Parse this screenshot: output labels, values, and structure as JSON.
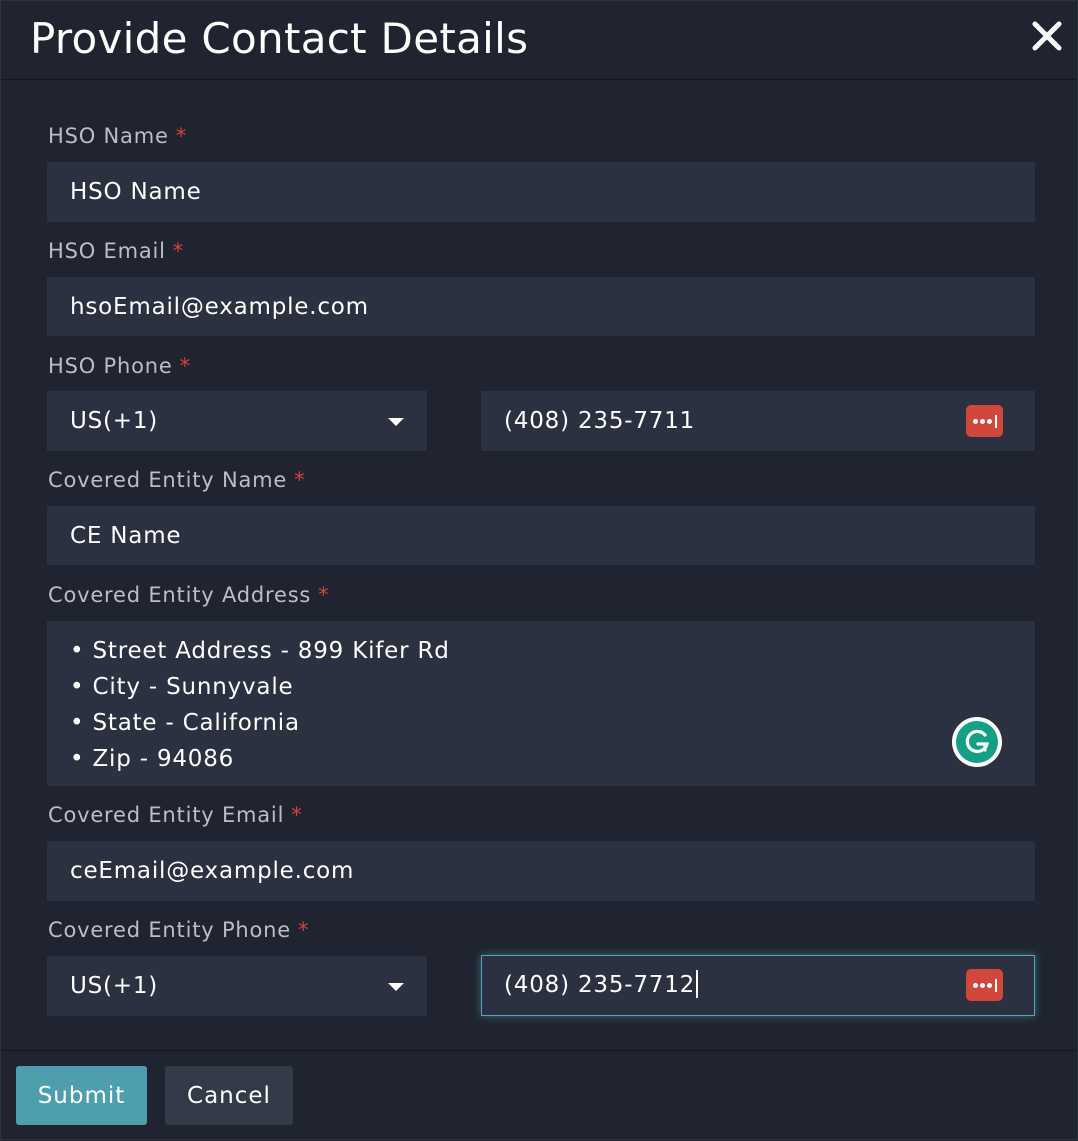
{
  "dialog": {
    "title": "Provide Contact Details",
    "required_marker": "*"
  },
  "form": {
    "hso_name": {
      "label": "HSO Name",
      "value": "HSO Name"
    },
    "hso_email": {
      "label": "HSO Email",
      "value": "hsoEmail@example.com"
    },
    "hso_phone": {
      "label": "HSO Phone",
      "country_code": "US(+1)",
      "value": "(408) 235-7711"
    },
    "ce_name": {
      "label": "Covered Entity Name",
      "value": "CE Name"
    },
    "ce_address": {
      "label": "Covered Entity Address",
      "lines": [
        "• Street Address - 899 Kifer Rd",
        "• City - Sunnyvale",
        "• State - California",
        "• Zip - 94086"
      ]
    },
    "ce_email": {
      "label": "Covered Entity Email",
      "value": "ceEmail@example.com"
    },
    "ce_phone": {
      "label": "Covered Entity Phone",
      "country_code": "US(+1)",
      "value": "(408) 235-7712"
    }
  },
  "footer": {
    "submit_label": "Submit",
    "cancel_label": "Cancel"
  },
  "colors": {
    "background": "#1f2430",
    "field_bg": "#2b3140",
    "required": "#d0453c",
    "primary_button": "#4d9fad",
    "secondary_button": "#333a48",
    "password_manager": "#d1473c",
    "focus_ring": "#5aa6b8"
  },
  "icons": {
    "close": "close-icon",
    "dropdown": "chevron-down-icon",
    "password_manager": "password-manager-icon",
    "grammarly": "grammarly-icon"
  }
}
